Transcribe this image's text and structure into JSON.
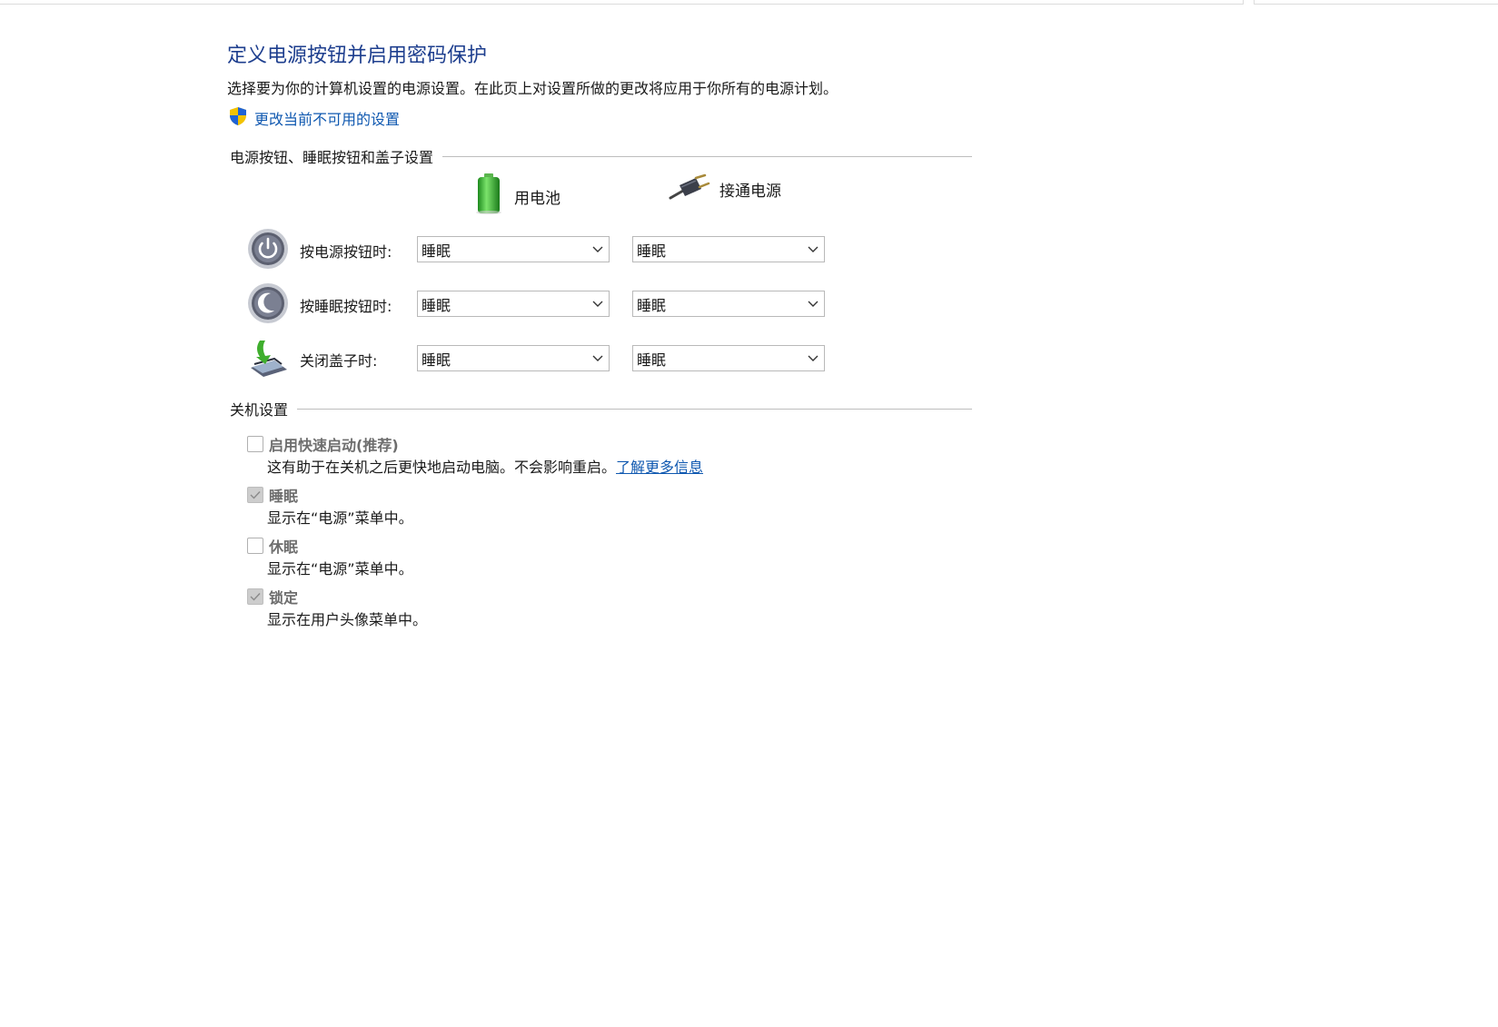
{
  "title": "定义电源按钮并启用密码保护",
  "description": "选择要为你的计算机设置的电源设置。在此页上对设置所做的更改将应用于你所有的电源计划。",
  "admin_link": {
    "label": "更改当前不可用的设置",
    "icon": "uac-shield-icon"
  },
  "power_buttons_group": {
    "title": "电源按钮、睡眠按钮和盖子设置",
    "columns": [
      {
        "label": "用电池",
        "icon": "battery-icon"
      },
      {
        "label": "接通电源",
        "icon": "power-plug-icon"
      }
    ],
    "rows": [
      {
        "label": "按电源按钮时:",
        "icon": "power-button-icon",
        "on_battery": "睡眠",
        "plugged_in": "睡眠"
      },
      {
        "label": "按睡眠按钮时:",
        "icon": "sleep-button-icon",
        "on_battery": "睡眠",
        "plugged_in": "睡眠"
      },
      {
        "label": "关闭盖子时:",
        "icon": "laptop-lid-icon",
        "on_battery": "睡眠",
        "plugged_in": "睡眠"
      }
    ]
  },
  "shutdown_group": {
    "title": "关机设置",
    "options": [
      {
        "label": "启用快速启动(推荐)",
        "checked": false,
        "enabled": false,
        "description": "这有助于在关机之后更快地启动电脑。不会影响重启。",
        "link": "了解更多信息"
      },
      {
        "label": "睡眠",
        "checked": true,
        "enabled": false,
        "description": "显示在“电源”菜单中。"
      },
      {
        "label": "休眠",
        "checked": false,
        "enabled": false,
        "description": "显示在“电源”菜单中。"
      },
      {
        "label": "锁定",
        "checked": true,
        "enabled": false,
        "description": "显示在用户头像菜单中。"
      }
    ]
  },
  "colors": {
    "title": "#1d3e8e",
    "link": "#0f58b0",
    "disabled_label": "#6d6d6d"
  }
}
